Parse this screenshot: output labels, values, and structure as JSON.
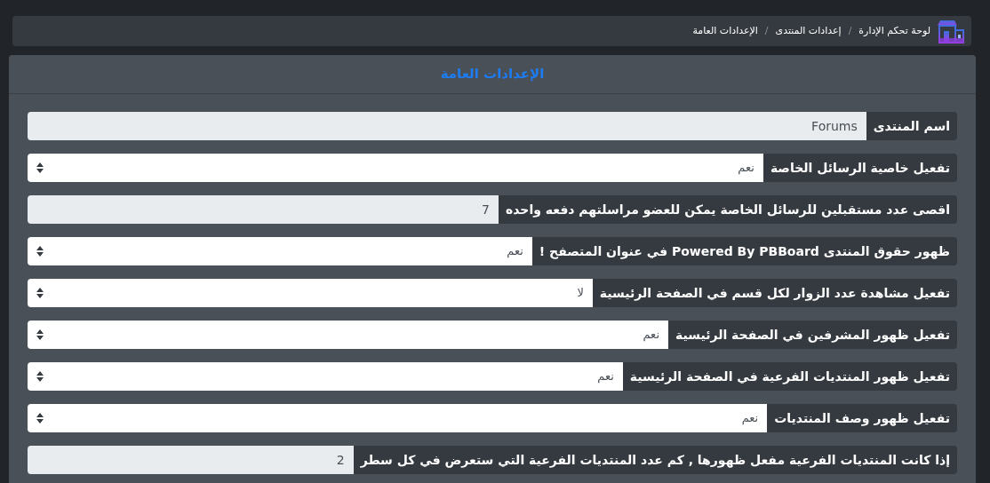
{
  "breadcrumb": {
    "separator": "/",
    "items": [
      {
        "label": "لوحة تحكم الإدارة"
      },
      {
        "label": "إعدادات المنتدى"
      },
      {
        "label": "الإعدادات العامة"
      }
    ]
  },
  "card": {
    "title": "الإعدادات العامة"
  },
  "settings": [
    {
      "kind": "text",
      "label": "اسم المنتدى",
      "value": "Forums"
    },
    {
      "kind": "select",
      "label": "تفعيل خاصية الرسائل الخاصة",
      "value": "نعم"
    },
    {
      "kind": "text",
      "label": "اقصى عدد مستقبلين للرسائل الخاصة يمكن للعضو مراسلتهم دفعه واحده",
      "value": "7"
    },
    {
      "kind": "select",
      "label": "ظهور حقوق المنتدى Powered By PBBoard في عنوان المتصفح !",
      "value": "نعم"
    },
    {
      "kind": "select",
      "label": "تفعيل مشاهدة عدد الزوار لكل قسم في الصفحة الرئيسية",
      "value": "لا"
    },
    {
      "kind": "select",
      "label": "تفعيل ظهور المشرفين في الصفحة الرئيسية",
      "value": "نعم"
    },
    {
      "kind": "select",
      "label": "تفعيل ظهور المنتديات الفرعية في الصفحة الرئيسية",
      "value": "نعم"
    },
    {
      "kind": "select",
      "label": "تفعيل ظهور وصف المنتديات",
      "value": "نعم"
    },
    {
      "kind": "text",
      "label": "إذا كانت المنتديات الفرعية مفعل ظهورها , كم عدد المنتديات الفرعية التي ستعرض في كل سطر",
      "value": "2"
    }
  ]
}
